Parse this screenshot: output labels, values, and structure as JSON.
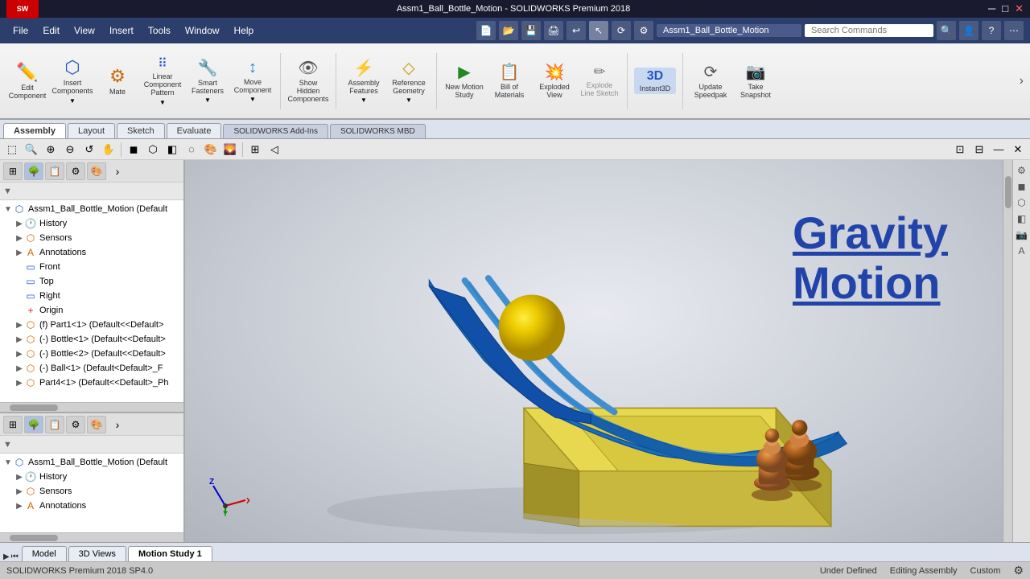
{
  "titlebar": {
    "title": "Assm1_Ball_Bottle_Motion - SOLIDWORKS Premium 2018",
    "controls": [
      "─",
      "□",
      "✕"
    ]
  },
  "menu": {
    "items": [
      "File",
      "Edit",
      "View",
      "Insert",
      "Tools",
      "Window",
      "Help"
    ]
  },
  "title_field": "Assm1_Ball_Bottle_Motion",
  "search_placeholder": "Search Commands",
  "ribbon": {
    "tabs": [
      "Assembly",
      "Layout",
      "Sketch",
      "Evaluate",
      "SOLIDWORKS Add-Ins",
      "SOLIDWORKS MBD"
    ],
    "active_tab": "Assembly",
    "buttons": [
      {
        "label": "Edit Component",
        "icon": "✏️"
      },
      {
        "label": "Insert Components",
        "icon": "🔩"
      },
      {
        "label": "Mate",
        "icon": "⚙"
      },
      {
        "label": "Linear Component Pattern",
        "icon": "⠿"
      },
      {
        "label": "Smart Fasteners",
        "icon": "🔧"
      },
      {
        "label": "Move Component",
        "icon": "↕"
      },
      {
        "label": "Show Hidden Components",
        "icon": "👁"
      },
      {
        "label": "Assembly Features",
        "icon": "⚡"
      },
      {
        "label": "Reference Geometry",
        "icon": "◇"
      },
      {
        "label": "New Motion Study",
        "icon": "▶"
      },
      {
        "label": "Bill of Materials",
        "icon": "📋"
      },
      {
        "label": "Exploded View",
        "icon": "💥"
      },
      {
        "label": "Explode Line Sketch",
        "icon": "✏"
      },
      {
        "label": "Instant3D",
        "icon": "3D"
      },
      {
        "label": "Update Speedpak",
        "icon": "⟳"
      },
      {
        "label": "Take Snapshot",
        "icon": "📷"
      }
    ]
  },
  "panel_top": {
    "filter_text": "▼",
    "root_label": "Assm1_Ball_Bottle_Motion (Default",
    "tree_items": [
      {
        "level": 1,
        "label": "History",
        "icon": "🕐",
        "type": "history"
      },
      {
        "level": 1,
        "label": "Sensors",
        "icon": "📡",
        "type": "sensor"
      },
      {
        "level": 1,
        "label": "Annotations",
        "icon": "A",
        "type": "annotation"
      },
      {
        "level": 1,
        "label": "Front",
        "icon": "▭",
        "type": "plane"
      },
      {
        "level": 1,
        "label": "Top",
        "icon": "▭",
        "type": "plane"
      },
      {
        "level": 1,
        "label": "Right",
        "icon": "▭",
        "type": "plane"
      },
      {
        "level": 1,
        "label": "Origin",
        "icon": "+",
        "type": "origin"
      },
      {
        "level": 1,
        "label": "(f) Part1<1> (Default<<Default>",
        "icon": "🔷",
        "type": "part"
      },
      {
        "level": 1,
        "label": "(-) Bottle<1> (Default<<Default>",
        "icon": "🔶",
        "type": "part"
      },
      {
        "level": 1,
        "label": "(-) Bottle<2> (Default<<Default>",
        "icon": "🔶",
        "type": "part"
      },
      {
        "level": 1,
        "label": "(-) Ball<1> (Default<Default>_F",
        "icon": "🔶",
        "type": "part"
      },
      {
        "level": 1,
        "label": "Part4<1> (Default<<Default>_Ph",
        "icon": "🔶",
        "type": "part"
      }
    ]
  },
  "panel_bottom": {
    "root_label": "Assm1_Ball_Bottle_Motion (Default",
    "tree_items": [
      {
        "level": 1,
        "label": "History",
        "icon": "🕐",
        "type": "history"
      },
      {
        "level": 1,
        "label": "Sensors",
        "icon": "📡",
        "type": "sensor"
      },
      {
        "level": 1,
        "label": "Annotations",
        "icon": "A",
        "type": "annotation"
      }
    ]
  },
  "viewport": {
    "gravity_text_line1": "Gravity",
    "gravity_text_line2": "Motion"
  },
  "bottom_tabs": [
    {
      "label": "Model",
      "active": false
    },
    {
      "label": "3D Views",
      "active": false
    },
    {
      "label": "Motion Study 1",
      "active": true
    }
  ],
  "statusbar": {
    "left": "SOLIDWORKS Premium 2018 SP4.0",
    "status1": "Under Defined",
    "status2": "Editing Assembly",
    "status3": "Custom"
  }
}
